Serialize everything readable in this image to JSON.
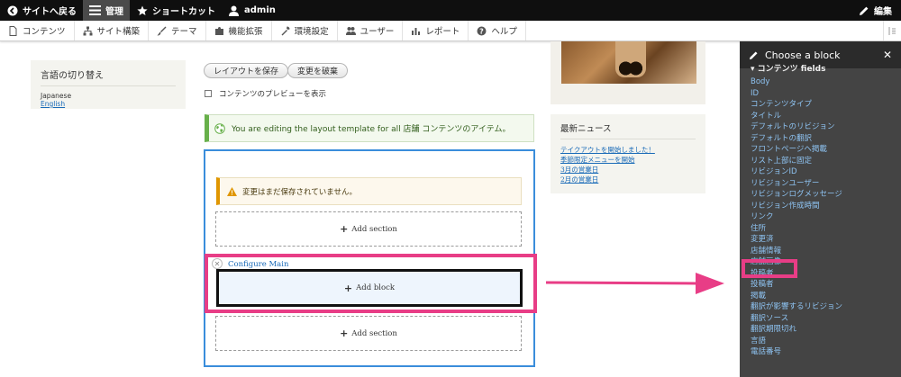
{
  "toolbar": {
    "back": "サイトへ戻る",
    "manage": "管理",
    "shortcuts": "ショートカット",
    "user": "admin",
    "edit": "編集"
  },
  "tray": {
    "items": [
      "コンテンツ",
      "サイト構築",
      "テーマ",
      "機能拡張",
      "環境設定",
      "ユーザー",
      "レポート",
      "ヘルプ"
    ]
  },
  "sidebar": {
    "language_title": "言語の切り替え",
    "languages": [
      "Japanese",
      "English"
    ]
  },
  "actions": {
    "save": "レイアウトを保存",
    "discard": "変更を破棄",
    "preview": "コンテンツのプレビューを表示"
  },
  "status_message": "You are editing the layout template for all 店舗 コンテンツのアイテム。",
  "layout": {
    "warning": "変更はまだ保存されていません。",
    "add_section": "Add section",
    "configure": "Configure Main",
    "add_block": "Add block"
  },
  "news": {
    "title": "最新ニュース",
    "items": [
      "テイクアウトを開始しました！",
      "季節限定メニューを開始",
      "3月の営業日",
      "2月の営業日"
    ]
  },
  "offcanvas": {
    "title": "Choose a block",
    "section": "▾ コンテンツ fields",
    "items": [
      "Body",
      "ID",
      "コンテンツタイプ",
      "タイトル",
      "デフォルトのリビジョン",
      "デフォルトの翻訳",
      "フロントページへ掲載",
      "リスト上部に固定",
      "リビジョンID",
      "リビジョンユーザー",
      "リビジョンログメッセージ",
      "リビジョン作成時間",
      "リンク",
      "住所",
      "変更済",
      "店舗情報",
      "店舗画像",
      "投稿者",
      "投稿者",
      "掲載",
      "翻訳が影響するリビジョン",
      "翻訳ソース",
      "翻訳期限切れ",
      "言語",
      "電話番号"
    ]
  },
  "colors": {
    "toolbar_bg": "#0f0f0f",
    "accent_highlight": "#e83d86",
    "link": "#1a6bb8",
    "offcanvas_bg": "#444444",
    "status_green": "#67b04a",
    "warning_orange": "#e09600"
  }
}
